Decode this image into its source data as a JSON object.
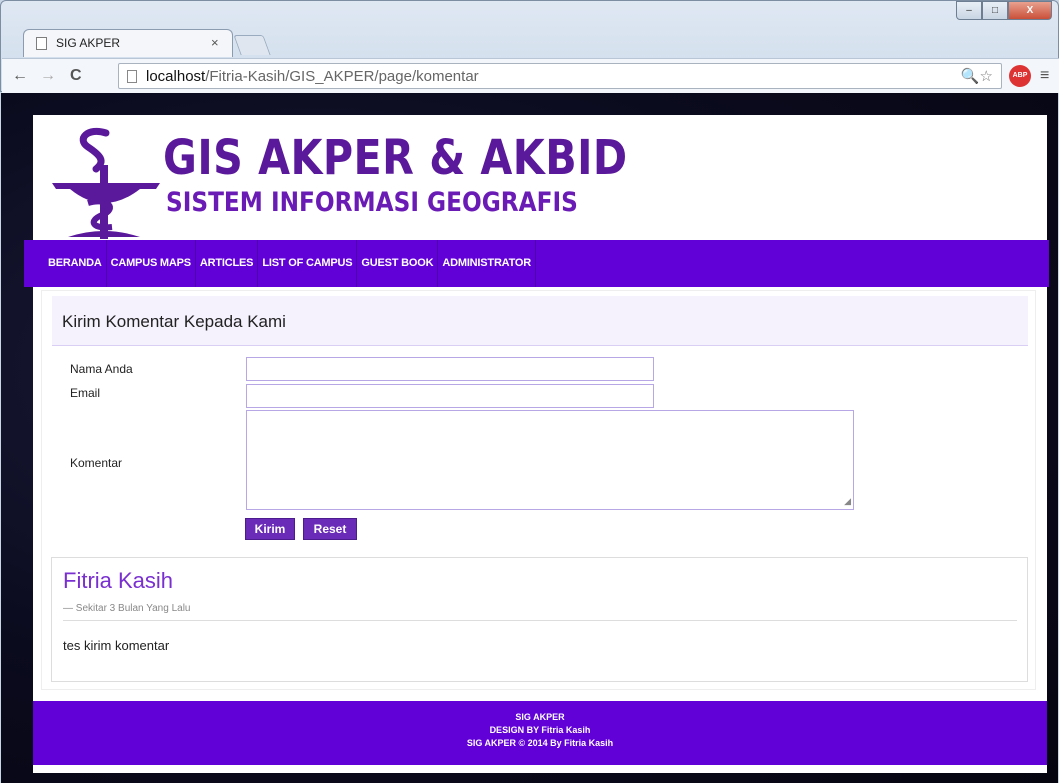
{
  "browser": {
    "tab_title": "SIG AKPER",
    "tab_close": "×",
    "url_host": "localhost",
    "url_path": "/Fitria-Kasih/GIS_AKPER/page/komentar",
    "back": "←",
    "forward": "→",
    "reload": "C",
    "zoom_star": "🔍☆",
    "abp": "ABP",
    "menu": "≡",
    "win_min": "‒",
    "win_max": "□",
    "win_close": "X"
  },
  "header": {
    "title": "GIS AKPER & AKBID",
    "subtitle": "SISTEM INFORMASI GEOGRAFIS"
  },
  "nav": {
    "items": [
      "BERANDA",
      "CAMPUS MAPS",
      "ARTICLES",
      "LIST OF CAMPUS",
      "GUEST BOOK",
      "ADMINISTRATOR"
    ]
  },
  "form": {
    "heading": "Kirim Komentar Kepada Kami",
    "name_label": "Nama Anda",
    "email_label": "Email",
    "comment_label": "Komentar",
    "name_value": "",
    "email_value": "",
    "comment_value": "",
    "submit_label": "Kirim",
    "reset_label": "Reset"
  },
  "comment": {
    "author": "Fitria Kasih",
    "time": "— Sekitar 3 Bulan Yang Lalu",
    "text": "tes kirim komentar"
  },
  "footer": {
    "line1": "SIG AKPER",
    "line2": "DESIGN BY Fitria Kasih",
    "line3": "SIG AKPER © 2014 By Fitria Kasih"
  },
  "colors": {
    "brand_purple": "#6200d8",
    "logo_purple": "#5a189a",
    "button_purple": "#6a2bb8",
    "comment_author": "#7a2fd0"
  },
  "icons": {
    "logo": "caduceus-icon",
    "page": "page-icon",
    "abp": "adblock-icon"
  }
}
